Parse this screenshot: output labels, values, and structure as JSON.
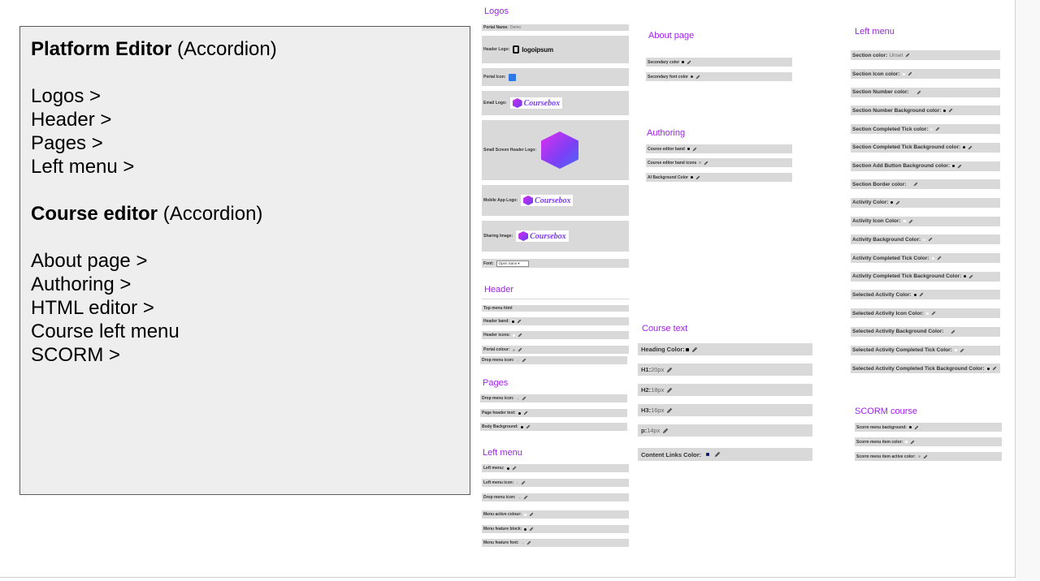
{
  "outline": {
    "platform_title": "Platform Editor",
    "platform_suffix": "(Accordion)",
    "platform_items": [
      "Logos >",
      "Header >",
      "Pages >",
      "Left menu >"
    ],
    "course_title": "Course editor",
    "course_suffix": "(Accordion)",
    "course_items": [
      "About page >",
      "Authoring >",
      "HTML editor >",
      "Course left menu",
      "SCORM >"
    ]
  },
  "logos": {
    "heading": "Logos",
    "portal_name_label": "Portal Name:",
    "portal_name_value": "Demo",
    "header_logo_label": "Header Logo:",
    "header_logo_text": "logoipsum",
    "portal_icon_label": "Portal Icon:",
    "email_logo_label": "Email Logo:",
    "small_screen_label": "Small Screen Header Logo:",
    "mobile_logo_label": "Mobile App Logo:",
    "sharing_label": "Sharing Image:",
    "brand_word": "Coursebox",
    "font_label": "Font:",
    "font_value": "Open Sans"
  },
  "header": {
    "heading": "Header",
    "items": [
      "Top menu html",
      "Header band:",
      "Header icons:",
      "Portal colour:",
      "Drop menu icon:"
    ]
  },
  "pages": {
    "heading": "Pages",
    "items": [
      "Drop menu icon:",
      "Page header text:",
      "Body Background:"
    ]
  },
  "left_menu_a": {
    "heading": "Left menu",
    "items": [
      "Left menu:",
      "Left menu icon:",
      "Drop menu icon:",
      "Menu active colour:",
      "Menu feature block:",
      "Menu feature font:"
    ]
  },
  "about": {
    "heading": "About page",
    "items": [
      "Secondary color",
      "Secondary font color"
    ]
  },
  "authoring": {
    "heading": "Authoring",
    "items": [
      "Course editor band",
      "Course editor band icons",
      "AI Background Color"
    ]
  },
  "course_text": {
    "heading": "Course text",
    "heading_color_label": "Heading Color:",
    "sizes": [
      {
        "label": "H1:",
        "value": "20px"
      },
      {
        "label": "H2:",
        "value": "18px"
      },
      {
        "label": "H3:",
        "value": "16px"
      },
      {
        "label": "p:",
        "value": "14px"
      }
    ],
    "links_label": "Content Links Color:"
  },
  "left_menu_b": {
    "heading": "Left menu",
    "section_color_label": "Section color:",
    "section_color_value": "Unset",
    "items": [
      "Section Icon color:",
      "Section Number color:",
      "Section Number Background color:",
      "Section Completed Tick color:",
      "Section Completed Tick Background color:",
      "Section Add Button Background color:",
      "Section Border color:",
      "Activity Color:",
      "Activity Icon Color:",
      "Activity Background Color:",
      "Activity Completed Tick Color:",
      "Activity Completed Tick Background Color:",
      "Selected Activity Color:",
      "Selected Activity Icon Color:",
      "Selected Activity Background Color:",
      "Selected Activity Completed Tick Color:",
      "Selected Activity Completed Tick Background Color:"
    ]
  },
  "scorm": {
    "heading": "SCORM course",
    "items": [
      "Scorm menu background:",
      "Scorm menu item color:",
      "Scorm menu item active color:"
    ]
  },
  "colors": {
    "accent": "#a020f0",
    "panel_bg": "#eeeeee",
    "bar_bg": "#d9d9d9"
  }
}
